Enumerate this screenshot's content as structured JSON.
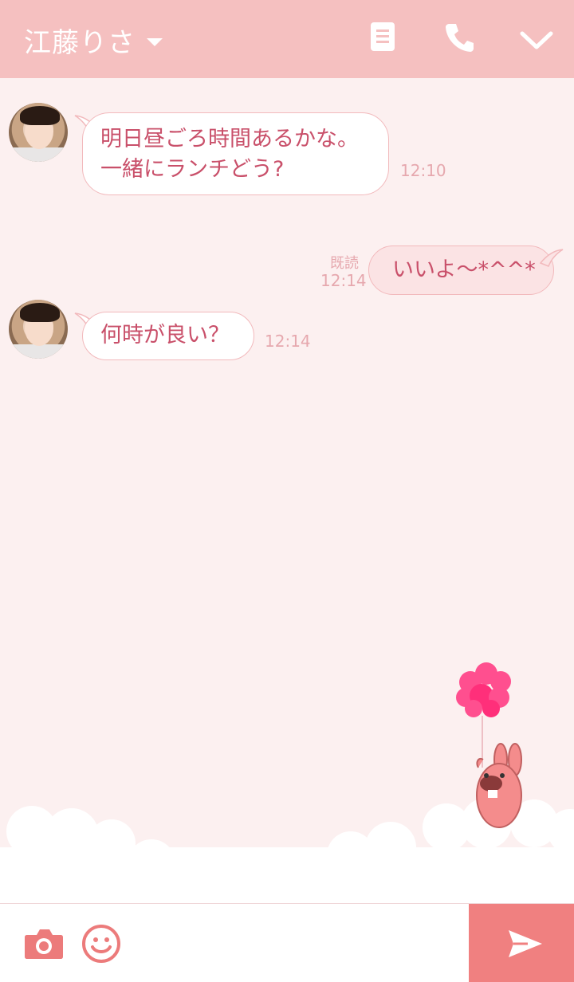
{
  "header": {
    "title": "江藤りさ",
    "icons": [
      "dropdown-caret-icon",
      "notes-icon",
      "phone-icon",
      "chevron-down-icon"
    ]
  },
  "messages": [
    {
      "sender": "other",
      "lines": [
        "明日昼ごろ時間あるかな。",
        "一緒にランチどう?"
      ],
      "time": "12:10"
    },
    {
      "sender": "me",
      "lines": [
        "いいよ〜*^^*"
      ],
      "read": "既読",
      "time": "12:14"
    },
    {
      "sender": "other",
      "lines": [
        "何時が良い？"
      ],
      "time": "12:14"
    }
  ],
  "footer": {
    "icons": [
      "camera-icon",
      "emoji-icon",
      "send-icon"
    ]
  },
  "colors": {
    "header_bg": "#f5c0c0",
    "chat_bg": "#fcf0f0",
    "text": "#c9506a",
    "send_bg": "#f08080",
    "balloon": "#ff4f8f"
  }
}
